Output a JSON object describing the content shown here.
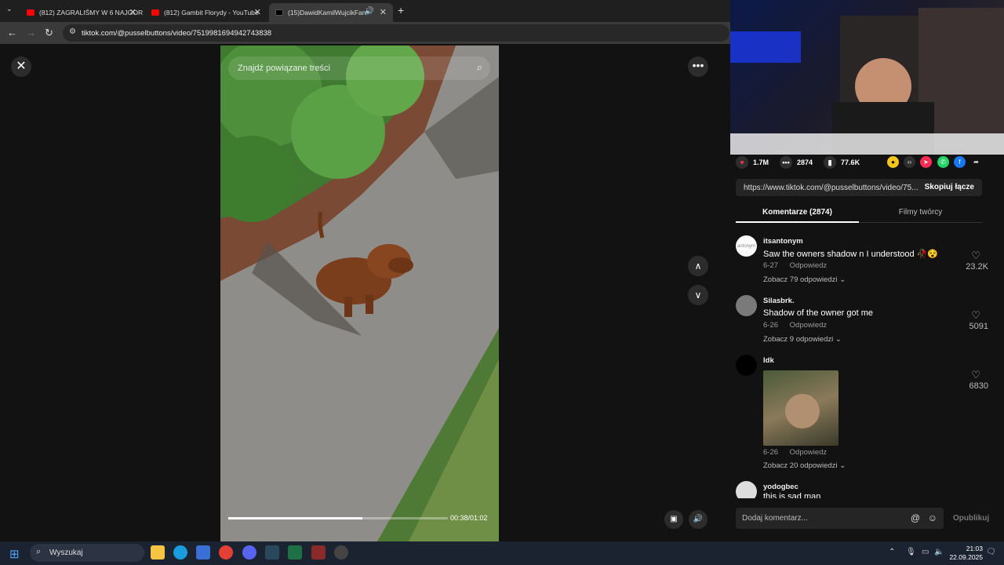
{
  "browser": {
    "tabs": [
      {
        "label": "(812) ZAGRALIŚMY W 6 NAJGOR",
        "icon": "youtube-icon"
      },
      {
        "label": "(812) Gambit Florydy - YouTube",
        "icon": "youtube-icon"
      },
      {
        "label": "(15)DawidKamilWujcikFam",
        "icon": "tiktok-icon"
      }
    ],
    "url": "tiktok.com/@pusselbuttons/video/7519981694942743838"
  },
  "video": {
    "search_placeholder": "Znajdź powiązane treści",
    "time": "00:38/01:02",
    "progress_fraction": 0.61
  },
  "stats": {
    "likes": "1.7M",
    "comments": "2874",
    "saves": "77.6K"
  },
  "link": {
    "url": "https://www.tiktok.com/@pusselbuttons/video/75...",
    "copy_label": "Skopiuj łącze"
  },
  "tabs": {
    "comments": "Komentarze (2874)",
    "creator": "Filmy twórcy"
  },
  "comments": [
    {
      "user": "itsantonym",
      "avatar_text": "antonym",
      "text": "Saw the owners shadow n I understood 🥀😵",
      "date": "6-27",
      "reply": "Odpowiedz",
      "more": "Zobacz 79 odpowiedzi",
      "likes": "23.2K"
    },
    {
      "user": "Silasbrk.",
      "text": "Shadow of the owner got me",
      "date": "6-26",
      "reply": "Odpowiedz",
      "more": "Zobacz 9 odpowiedzi",
      "likes": "5091"
    },
    {
      "user": "Idk",
      "text": "",
      "date": "6-26",
      "reply": "Odpowiedz",
      "more": "Zobacz 20 odpowiedzi",
      "likes": "6830"
    },
    {
      "user": "yodogbec",
      "text": "this is sad man"
    }
  ],
  "composer": {
    "placeholder": "Dodaj komentarz...",
    "publish": "Opublikuj"
  },
  "taskbar": {
    "search": "Wyszukaj",
    "time": "21:03",
    "date": "22.09.2025"
  },
  "colors": {
    "tiktok_red": "#fe2c55",
    "panel_bg": "#121212"
  }
}
